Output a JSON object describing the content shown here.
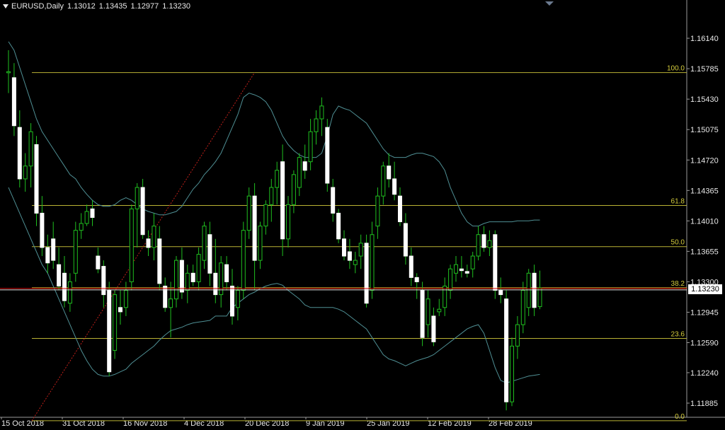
{
  "header": {
    "symbol": "EURUSD,Daily",
    "open": "1.13012",
    "high": "1.13435",
    "low": "1.12977",
    "close": "1.13230"
  },
  "current_price_label": "1.13230",
  "colors": {
    "background": "#000000",
    "candle_body": "#ffffff",
    "candle_wick": "#1fbf1f",
    "bollinger": "#4f8f94",
    "fib_line": "#b9b234",
    "fib_text": "#d4cc3c",
    "trend_line": "#c0201a",
    "current_line": "#d80000",
    "axis_text": "#e8e8e8"
  },
  "chart_data": {
    "type": "candlestick",
    "y_axis_ticks": [
      "1.16140",
      "1.15785",
      "1.15430",
      "1.15075",
      "1.14720",
      "1.14365",
      "1.14010",
      "1.13655",
      "1.13300",
      "1.12945",
      "1.12590",
      "1.12240",
      "1.11885"
    ],
    "x_axis_ticks": [
      "15 Oct 2018",
      "31 Oct 2018",
      "16 Nov 2018",
      "4 Dec 2018",
      "20 Dec 2018",
      "9 Jan 2019",
      "25 Jan 2019",
      "12 Feb 2019",
      "28 Feb 2019"
    ],
    "ylim": [
      1.1172,
      1.1652
    ],
    "fibonacci": [
      {
        "label": "100.0",
        "price": 1.1574
      },
      {
        "label": "61.8",
        "price": 1.1419
      },
      {
        "label": "50.0",
        "price": 1.1371
      },
      {
        "label": "38.2",
        "price": 1.1323
      },
      {
        "label": "23.6",
        "price": 1.1264
      },
      {
        "label": "0.0",
        "price": 1.1168
      }
    ],
    "current_price": 1.1323,
    "trend_line": [
      {
        "bar": 0,
        "price": 1.1168
      },
      {
        "bar": 44,
        "price": 1.1574
      }
    ],
    "candles": [
      [
        1.1575,
        1.16,
        1.155,
        1.1575
      ],
      [
        1.1568,
        1.1585,
        1.15,
        1.1512
      ],
      [
        1.151,
        1.153,
        1.144,
        1.145
      ],
      [
        1.145,
        1.148,
        1.1435,
        1.1465
      ],
      [
        1.1465,
        1.1515,
        1.144,
        1.1505
      ],
      [
        1.149,
        1.15,
        1.1395,
        1.141
      ],
      [
        1.141,
        1.143,
        1.136,
        1.137
      ],
      [
        1.137,
        1.1385,
        1.134,
        1.1352
      ],
      [
        1.138,
        1.14,
        1.1345,
        1.1355
      ],
      [
        1.135,
        1.137,
        1.132,
        1.1325
      ],
      [
        1.134,
        1.136,
        1.13,
        1.1308
      ],
      [
        1.1305,
        1.134,
        1.1295,
        1.133
      ],
      [
        1.134,
        1.14,
        1.133,
        1.139
      ],
      [
        1.139,
        1.141,
        1.138,
        1.1398
      ],
      [
        1.1398,
        1.142,
        1.1395,
        1.1412
      ],
      [
        1.1415,
        1.1425,
        1.1395,
        1.1405
      ],
      [
        1.136,
        1.137,
        1.134,
        1.1345
      ],
      [
        1.1348,
        1.1355,
        1.13,
        1.1315
      ],
      [
        1.132,
        1.133,
        1.122,
        1.1225
      ],
      [
        1.125,
        1.132,
        1.124,
        1.1315
      ],
      [
        1.13,
        1.132,
        1.128,
        1.1295
      ],
      [
        1.13,
        1.133,
        1.129,
        1.132
      ],
      [
        1.133,
        1.142,
        1.132,
        1.1415
      ],
      [
        1.1415,
        1.1445,
        1.137,
        1.144
      ],
      [
        1.144,
        1.145,
        1.138,
        1.1385
      ],
      [
        1.138,
        1.139,
        1.136,
        1.137
      ],
      [
        1.137,
        1.141,
        1.1355,
        1.1395
      ],
      [
        1.138,
        1.1395,
        1.132,
        1.1328
      ],
      [
        1.1325,
        1.1335,
        1.1295,
        1.13
      ],
      [
        1.13,
        1.133,
        1.1265,
        1.131
      ],
      [
        1.131,
        1.136,
        1.13,
        1.1355
      ],
      [
        1.1355,
        1.137,
        1.131,
        1.1318
      ],
      [
        1.132,
        1.135,
        1.1305,
        1.134
      ],
      [
        1.134,
        1.135,
        1.1325,
        1.133
      ],
      [
        1.133,
        1.137,
        1.132,
        1.1362
      ],
      [
        1.1355,
        1.14,
        1.1345,
        1.1395
      ],
      [
        1.1385,
        1.14,
        1.1325,
        1.134
      ],
      [
        1.134,
        1.138,
        1.1305,
        1.1315
      ],
      [
        1.1315,
        1.136,
        1.13,
        1.1352
      ],
      [
        1.135,
        1.136,
        1.132,
        1.133
      ],
      [
        1.1325,
        1.1345,
        1.128,
        1.129
      ],
      [
        1.13,
        1.1325,
        1.1285,
        1.132
      ],
      [
        1.132,
        1.14,
        1.131,
        1.139
      ],
      [
        1.139,
        1.144,
        1.138,
        1.143
      ],
      [
        1.143,
        1.1445,
        1.132,
        1.1355
      ],
      [
        1.1355,
        1.14,
        1.1345,
        1.1395
      ],
      [
        1.1395,
        1.1425,
        1.1385,
        1.142
      ],
      [
        1.142,
        1.145,
        1.14,
        1.144
      ],
      [
        1.144,
        1.147,
        1.142,
        1.146
      ],
      [
        1.147,
        1.149,
        1.136,
        1.138
      ],
      [
        1.138,
        1.143,
        1.137,
        1.142
      ],
      [
        1.142,
        1.146,
        1.141,
        1.1455
      ],
      [
        1.144,
        1.148,
        1.143,
        1.1475
      ],
      [
        1.147,
        1.149,
        1.145,
        1.146
      ],
      [
        1.147,
        1.152,
        1.146,
        1.1505
      ],
      [
        1.1505,
        1.153,
        1.149,
        1.152
      ],
      [
        1.152,
        1.1545,
        1.15,
        1.1535
      ],
      [
        1.151,
        1.152,
        1.1435,
        1.1445
      ],
      [
        1.144,
        1.145,
        1.14,
        1.141
      ],
      [
        1.141,
        1.1415,
        1.1375,
        1.138
      ],
      [
        1.138,
        1.139,
        1.1355,
        1.136
      ],
      [
        1.1365,
        1.138,
        1.1345,
        1.1355
      ],
      [
        1.135,
        1.1365,
        1.134,
        1.1355
      ],
      [
        1.136,
        1.1385,
        1.1345,
        1.1375
      ],
      [
        1.1375,
        1.1385,
        1.13,
        1.1305
      ],
      [
        1.132,
        1.14,
        1.131,
        1.1385
      ],
      [
        1.1395,
        1.144,
        1.138,
        1.143
      ],
      [
        1.143,
        1.147,
        1.142,
        1.1465
      ],
      [
        1.1465,
        1.148,
        1.144,
        1.145
      ],
      [
        1.145,
        1.147,
        1.1425,
        1.1432
      ],
      [
        1.143,
        1.144,
        1.1395,
        1.14
      ],
      [
        1.1398,
        1.141,
        1.135,
        1.136
      ],
      [
        1.136,
        1.137,
        1.1325,
        1.1335
      ],
      [
        1.1335,
        1.134,
        1.131,
        1.133
      ],
      [
        1.132,
        1.133,
        1.1255,
        1.1265
      ],
      [
        1.128,
        1.132,
        1.1265,
        1.131
      ],
      [
        1.129,
        1.13,
        1.1255,
        1.126
      ],
      [
        1.1295,
        1.131,
        1.129,
        1.1298
      ],
      [
        1.13,
        1.1335,
        1.129,
        1.1325
      ],
      [
        1.132,
        1.135,
        1.131,
        1.1345
      ],
      [
        1.134,
        1.136,
        1.133,
        1.135
      ],
      [
        1.1345,
        1.136,
        1.1335,
        1.1343
      ],
      [
        1.1342,
        1.135,
        1.1335,
        1.134
      ],
      [
        1.1345,
        1.1365,
        1.1335,
        1.136
      ],
      [
        1.136,
        1.1395,
        1.1355,
        1.1385
      ],
      [
        1.1385,
        1.1395,
        1.1365,
        1.137
      ],
      [
        1.137,
        1.139,
        1.136,
        1.1378
      ],
      [
        1.1385,
        1.139,
        1.131,
        1.132
      ],
      [
        1.132,
        1.1335,
        1.1305,
        1.1315
      ],
      [
        1.131,
        1.132,
        1.118,
        1.119
      ],
      [
        1.119,
        1.1265,
        1.1185,
        1.1255
      ],
      [
        1.1255,
        1.129,
        1.124,
        1.128
      ],
      [
        1.128,
        1.133,
        1.127,
        1.132
      ],
      [
        1.13,
        1.1345,
        1.129,
        1.134
      ],
      [
        1.134,
        1.135,
        1.129,
        1.13
      ],
      [
        1.1301,
        1.1343,
        1.1298,
        1.1323
      ]
    ],
    "bollinger_upper": [
      1.161,
      1.16,
      1.158,
      1.156,
      1.154,
      1.152,
      1.1505,
      1.1495,
      1.1485,
      1.1475,
      1.1465,
      1.1455,
      1.145,
      1.144,
      1.1432,
      1.1425,
      1.142,
      1.1418,
      1.1418,
      1.142,
      1.1425,
      1.1428,
      1.1425,
      1.142,
      1.1415,
      1.1412,
      1.141,
      1.1408,
      1.1408,
      1.141,
      1.1412,
      1.1418,
      1.1428,
      1.1438,
      1.1445,
      1.1455,
      1.1462,
      1.147,
      1.148,
      1.1495,
      1.151,
      1.1525,
      1.1545,
      1.155,
      1.1548,
      1.1545,
      1.154,
      1.153,
      1.1515,
      1.15,
      1.149,
      1.1483,
      1.1478,
      1.1475,
      1.1475,
      1.1475,
      1.148,
      1.15,
      1.1525,
      1.1535,
      1.1532,
      1.153,
      1.1525,
      1.152,
      1.1515,
      1.1505,
      1.1495,
      1.1485,
      1.1478,
      1.1475,
      1.1475,
      1.1475,
      1.1478,
      1.148,
      1.148,
      1.1478,
      1.1476,
      1.147,
      1.146,
      1.144,
      1.1425,
      1.141,
      1.14,
      1.1395,
      1.1395,
      1.1398,
      1.14,
      1.14,
      1.14,
      1.14,
      1.14,
      1.1401,
      1.1401,
      1.1401,
      1.1402,
      1.1402
    ],
    "bollinger_lower": [
      1.144,
      1.1425,
      1.141,
      1.1395,
      1.138,
      1.1365,
      1.135,
      1.134,
      1.1325,
      1.131,
      1.1295,
      1.128,
      1.1265,
      1.125,
      1.1238,
      1.1228,
      1.1222,
      1.122,
      1.122,
      1.1222,
      1.1225,
      1.1228,
      1.1235,
      1.124,
      1.1245,
      1.125,
      1.1255,
      1.1262,
      1.1268,
      1.1273,
      1.1275,
      1.1277,
      1.128,
      1.1282,
      1.1283,
      1.1284,
      1.1285,
      1.129,
      1.129,
      1.129,
      1.13,
      1.1305,
      1.131,
      1.1315,
      1.1318,
      1.1322,
      1.1325,
      1.1327,
      1.1328,
      1.1326,
      1.132,
      1.1315,
      1.131,
      1.1303,
      1.13,
      1.13,
      1.13,
      1.13,
      1.13,
      1.1298,
      1.1295,
      1.129,
      1.1285,
      1.128,
      1.1275,
      1.1265,
      1.1255,
      1.1245,
      1.124,
      1.1238,
      1.1235,
      1.1232,
      1.1235,
      1.1238,
      1.124,
      1.1242,
      1.1245,
      1.125,
      1.1255,
      1.126,
      1.1265,
      1.127,
      1.1275,
      1.1278,
      1.128,
      1.127,
      1.125,
      1.123,
      1.1215,
      1.1212,
      1.1214,
      1.1216,
      1.1218,
      1.122,
      1.1221,
      1.1222
    ]
  }
}
